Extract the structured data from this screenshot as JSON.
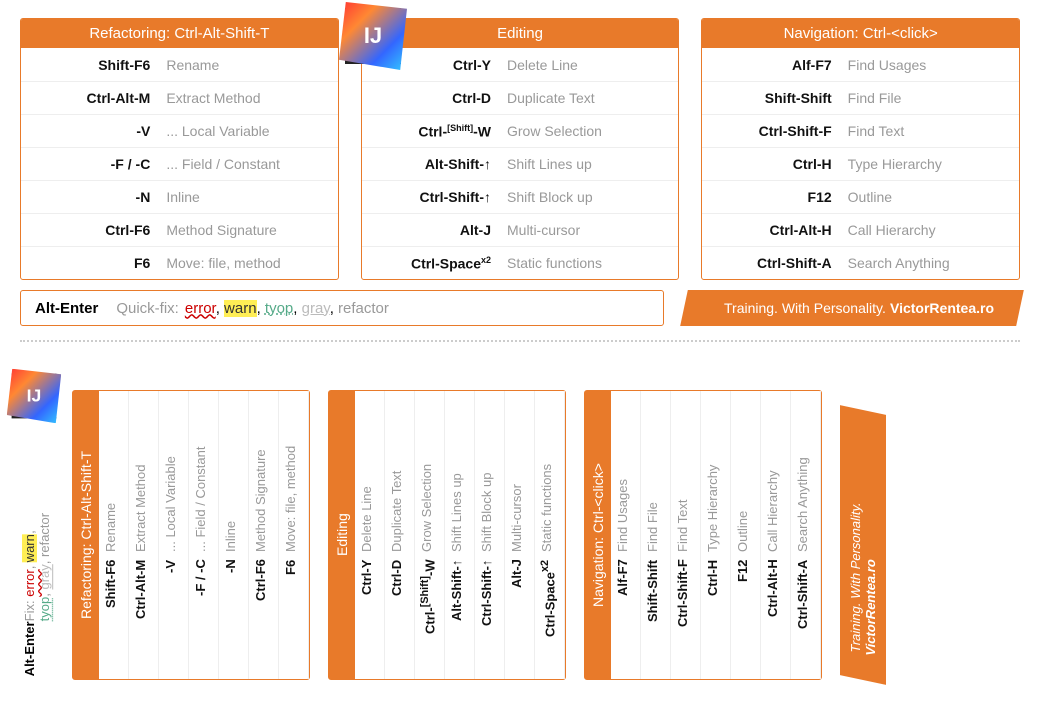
{
  "refactoring": {
    "title": "Refactoring:",
    "sub": "Ctrl-Alt-Shift-T",
    "rows": [
      {
        "key": "Shift-F6",
        "desc": "Rename"
      },
      {
        "key": "Ctrl-Alt-<b class='m-bold'>M</b>",
        "desc": "Extract Method"
      },
      {
        "key": "-<b class='m-bold'>V</b>",
        "desc": "... Local Variable"
      },
      {
        "key": "-<b class='m-bold'>F</b> / -<b class='m-bold'>C</b>",
        "desc": "... Field / Constant"
      },
      {
        "key": "-<b class='m-bold'>N</b>",
        "desc": "Inline"
      },
      {
        "key": "Ctrl-F6",
        "desc": "Method Signature"
      },
      {
        "key": "F6",
        "desc": "Move: file, method"
      }
    ]
  },
  "editing": {
    "title": "Editing",
    "rows": [
      {
        "key": "Ctrl-Y",
        "desc": "Delete Line"
      },
      {
        "key": "Ctrl-D",
        "desc": "Duplicate Text"
      },
      {
        "key": "Ctrl-<sup>[Shift]</sup>-W",
        "desc": "Grow Selection"
      },
      {
        "key": "Alt-Shift-↑",
        "desc": "Shift Lines up"
      },
      {
        "key": "Ctrl-Shift-↑",
        "desc": "Shift Block up"
      },
      {
        "key": "Alt-J",
        "desc": "Multi-cursor"
      },
      {
        "key": "Ctrl-Space<sup>x2</sup>",
        "desc": "Static functions"
      }
    ]
  },
  "navigation": {
    "title": "Navigation:",
    "sub": "Ctrl-<click>",
    "rows": [
      {
        "key": "Alf-F7",
        "desc": "Find Usages"
      },
      {
        "key": "Shift-Shift",
        "desc": "Find File"
      },
      {
        "key": "Ctrl-Shift-F",
        "desc": "Find Text"
      },
      {
        "key": "Ctrl-H",
        "desc": "Type Hierarchy"
      },
      {
        "key": "F12",
        "desc": "Outline"
      },
      {
        "key": "Ctrl-Alt-H",
        "desc": "Call Hierarchy"
      },
      {
        "key": "Ctrl-Shift-A",
        "desc": "Search Anything"
      }
    ]
  },
  "quickfix": {
    "key": "Alt-Enter",
    "label": "Quick-fix:",
    "parts": [
      "error",
      "warn",
      "tyop",
      "gray",
      "refactor"
    ],
    "short_label": "Fix:"
  },
  "promo": {
    "line1": "Training. With Personality.",
    "line2": "VictorRentea.ro"
  },
  "logo": "IJ"
}
